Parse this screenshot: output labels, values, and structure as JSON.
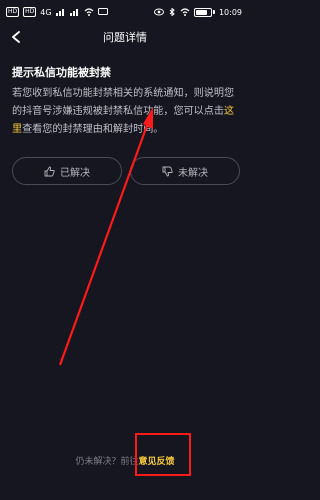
{
  "status_bar": {
    "left_badges": [
      "HD",
      "HD"
    ],
    "signal_text": "4G",
    "right_text": "10:09"
  },
  "header": {
    "title": "问题详情"
  },
  "article": {
    "title": "提示私信功能被封禁",
    "text_before_link": "若您收到私信功能封禁相关的系统通知，则说明您的抖音号涉嫌违规被封禁私信功能，您可以点击",
    "link_text": "这里",
    "text_after_link": "查看您的封禁理由和解封时间。"
  },
  "feedback": {
    "solved_label": "已解决",
    "unsolved_label": "未解决"
  },
  "footer": {
    "prompt": "仍未解决？前往",
    "link_label": "意见反馈"
  },
  "colors": {
    "background": "#15161f",
    "accent": "#f5c93e",
    "annotation_red": "#ff1a1a"
  }
}
